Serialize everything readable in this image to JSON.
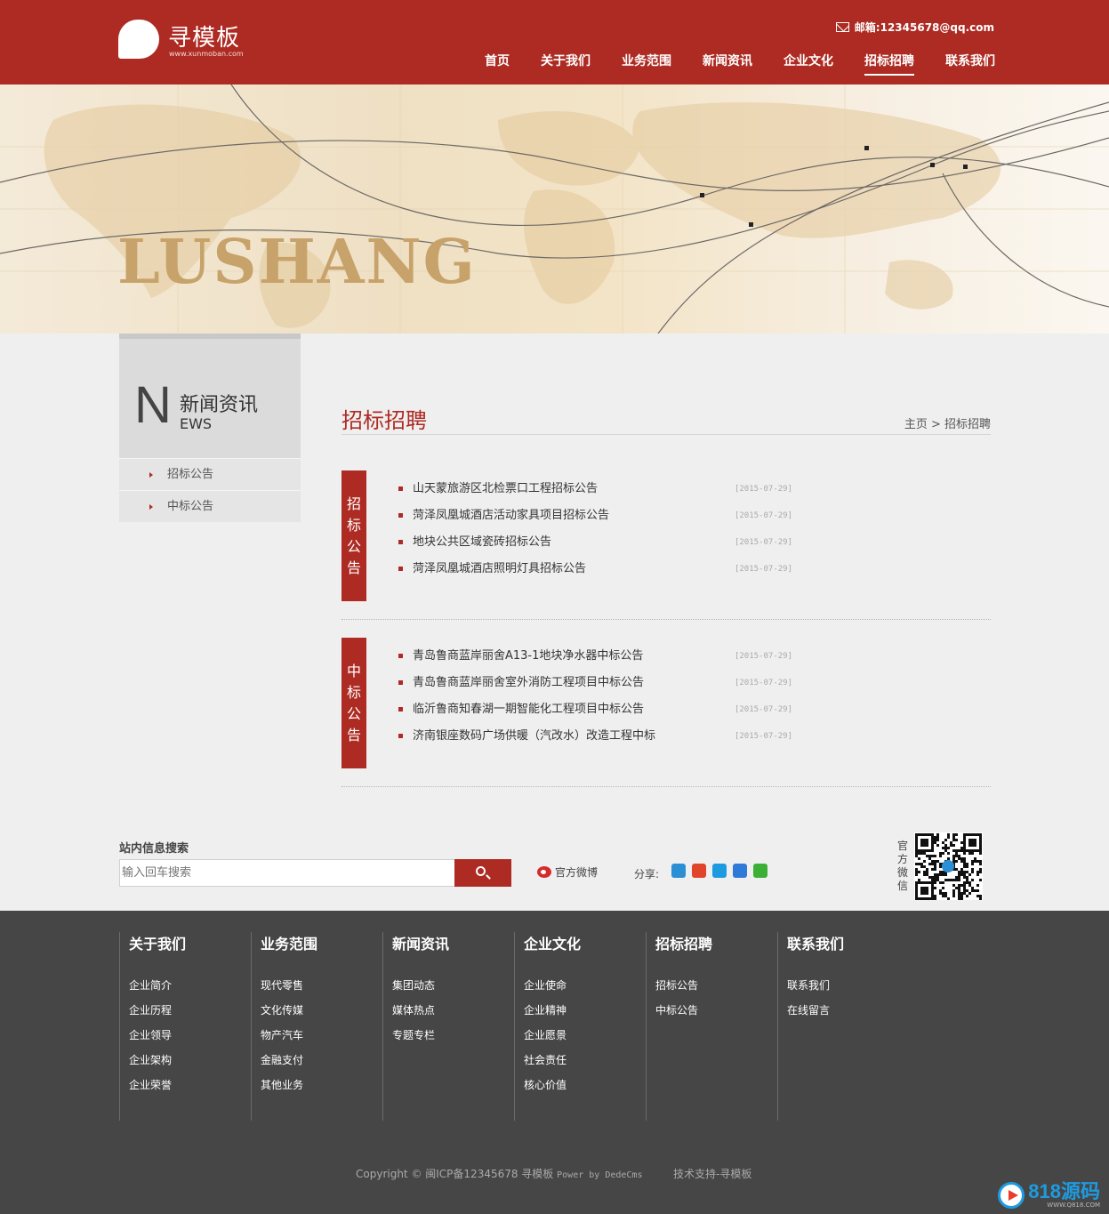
{
  "header": {
    "logo_text": "寻模板",
    "logo_url": "www.xunmoban.com",
    "email": "邮箱:12345678@qq.com",
    "nav": [
      {
        "label": "首页",
        "active": false
      },
      {
        "label": "关于我们",
        "active": false
      },
      {
        "label": "业务范围",
        "active": false
      },
      {
        "label": "新闻资讯",
        "active": false
      },
      {
        "label": "企业文化",
        "active": false
      },
      {
        "label": "招标招聘",
        "active": true
      },
      {
        "label": "联系我们",
        "active": false
      }
    ]
  },
  "banner": {
    "word": "LUSHANG"
  },
  "sidebar": {
    "letter": "N",
    "title": "新闻资讯",
    "sub": "EWS",
    "items": [
      {
        "label": "招标公告"
      },
      {
        "label": "中标公告"
      }
    ]
  },
  "main": {
    "title": "招标招聘",
    "breadcrumb": "主页 > 招标招聘",
    "sections": [
      {
        "label_chars": [
          "招",
          "标",
          "公",
          "告"
        ],
        "items": [
          {
            "title": "山天蒙旅游区北检票口工程招标公告",
            "date": "[2015-07-29]"
          },
          {
            "title": "菏泽凤凰城酒店活动家具项目招标公告",
            "date": "[2015-07-29]"
          },
          {
            "title": "地块公共区域瓷砖招标公告",
            "date": "[2015-07-29]"
          },
          {
            "title": "菏泽凤凰城酒店照明灯具招标公告",
            "date": "[2015-07-29]"
          }
        ]
      },
      {
        "label_chars": [
          "中",
          "标",
          "公",
          "告"
        ],
        "items": [
          {
            "title": "青岛鲁商蓝岸丽舍A13-1地块净水器中标公告",
            "date": "[2015-07-29]"
          },
          {
            "title": "青岛鲁商蓝岸丽舍室外消防工程项目中标公告",
            "date": "[2015-07-29]"
          },
          {
            "title": "临沂鲁商知春湖一期智能化工程项目中标公告",
            "date": "[2015-07-29]"
          },
          {
            "title": "济南银座数码广场供暖（汽改水）改造工程中标",
            "date": "[2015-07-29]"
          }
        ]
      }
    ]
  },
  "search": {
    "label": "站内信息搜索",
    "placeholder": "输入回车搜索",
    "weibo": "官方微博",
    "share": "分享:",
    "qr_label": "官方微信"
  },
  "share_colors": [
    "#2b8fd6",
    "#e0452b",
    "#1e9be0",
    "#2f7ad8",
    "#3cb035"
  ],
  "footer": {
    "columns": [
      {
        "title": "关于我们",
        "links": [
          "企业简介",
          "企业历程",
          "企业领导",
          "企业架构",
          "企业荣誉"
        ]
      },
      {
        "title": "业务范围",
        "links": [
          "现代零售",
          "文化传媒",
          "物产汽车",
          "金融支付",
          "其他业务"
        ]
      },
      {
        "title": "新闻资讯",
        "links": [
          "集团动态",
          "媒体热点",
          "专题专栏"
        ]
      },
      {
        "title": "企业文化",
        "links": [
          "企业使命",
          "企业精神",
          "企业愿景",
          "社会责任",
          "核心价值"
        ]
      },
      {
        "title": "招标招聘",
        "links": [
          "招标公告",
          "中标公告"
        ]
      },
      {
        "title": "联系我们",
        "links": [
          "联系我们",
          "在线留言"
        ]
      }
    ],
    "copyright": "Copyright © 闽ICP备12345678 寻模板",
    "power": "Power by DedeCms",
    "tech": "技术支持-寻模板",
    "watermark": "818源码",
    "watermark_url": "WWW.Q818.COM"
  }
}
